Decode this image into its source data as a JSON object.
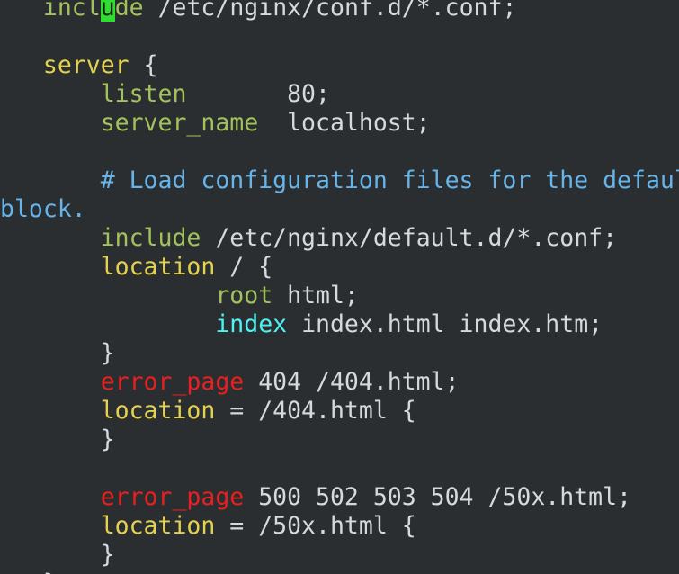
{
  "editor": {
    "lines": [
      [
        {
          "t": "   "
        },
        {
          "t": "inc",
          "c": "ygreen"
        },
        {
          "t": "l",
          "c": "ygreen"
        },
        {
          "t": "u",
          "c": "cursor"
        },
        {
          "t": "de",
          "c": "ygreen"
        },
        {
          "t": " /etc/nginx/conf.d/*.conf;"
        }
      ],
      [],
      [
        {
          "t": "   "
        },
        {
          "t": "server",
          "c": "yellow"
        },
        {
          "t": " {"
        }
      ],
      [
        {
          "t": "       "
        },
        {
          "t": "listen",
          "c": "ygreen"
        },
        {
          "t": "       80;"
        }
      ],
      [
        {
          "t": "       "
        },
        {
          "t": "server_name",
          "c": "ygreen"
        },
        {
          "t": "  localhost;"
        }
      ],
      [],
      [
        {
          "t": "       "
        },
        {
          "t": "# Load configuration files for the defaul",
          "c": "blue"
        }
      ],
      [
        {
          "t": "block.",
          "c": "blue"
        }
      ],
      [
        {
          "t": "       "
        },
        {
          "t": "include",
          "c": "ygreen"
        },
        {
          "t": " /etc/nginx/default.d/*.conf;"
        }
      ],
      [
        {
          "t": "       "
        },
        {
          "t": "location",
          "c": "yellow"
        },
        {
          "t": " / {"
        }
      ],
      [
        {
          "t": "               "
        },
        {
          "t": "root",
          "c": "ygreen"
        },
        {
          "t": " html;"
        }
      ],
      [
        {
          "t": "               "
        },
        {
          "t": "index",
          "c": "cyan"
        },
        {
          "t": " index.html index.htm;"
        }
      ],
      [
        {
          "t": "       }"
        }
      ],
      [
        {
          "t": "       "
        },
        {
          "t": "error_page",
          "c": "red"
        },
        {
          "t": " 404 /404.html;"
        }
      ],
      [
        {
          "t": "       "
        },
        {
          "t": "location",
          "c": "yellow"
        },
        {
          "t": " = /404.html {"
        }
      ],
      [
        {
          "t": "       }"
        }
      ],
      [],
      [
        {
          "t": "       "
        },
        {
          "t": "error_page",
          "c": "red"
        },
        {
          "t": " 500 502 503 504 /50x.html;"
        }
      ],
      [
        {
          "t": "       "
        },
        {
          "t": "location",
          "c": "yellow"
        },
        {
          "t": " = /50x.html {"
        }
      ],
      [
        {
          "t": "       }"
        }
      ],
      [
        {
          "t": "   }"
        }
      ]
    ]
  },
  "colors": {
    "background": "#2b2e31",
    "text": "#d7dadc",
    "directive": "#a4c25c",
    "block_keyword": "#e3d24f",
    "comment": "#66b4e8",
    "error_page": "#ea1f1f",
    "index_keyword": "#4ff2f2",
    "cursor": "#2ee02e"
  }
}
